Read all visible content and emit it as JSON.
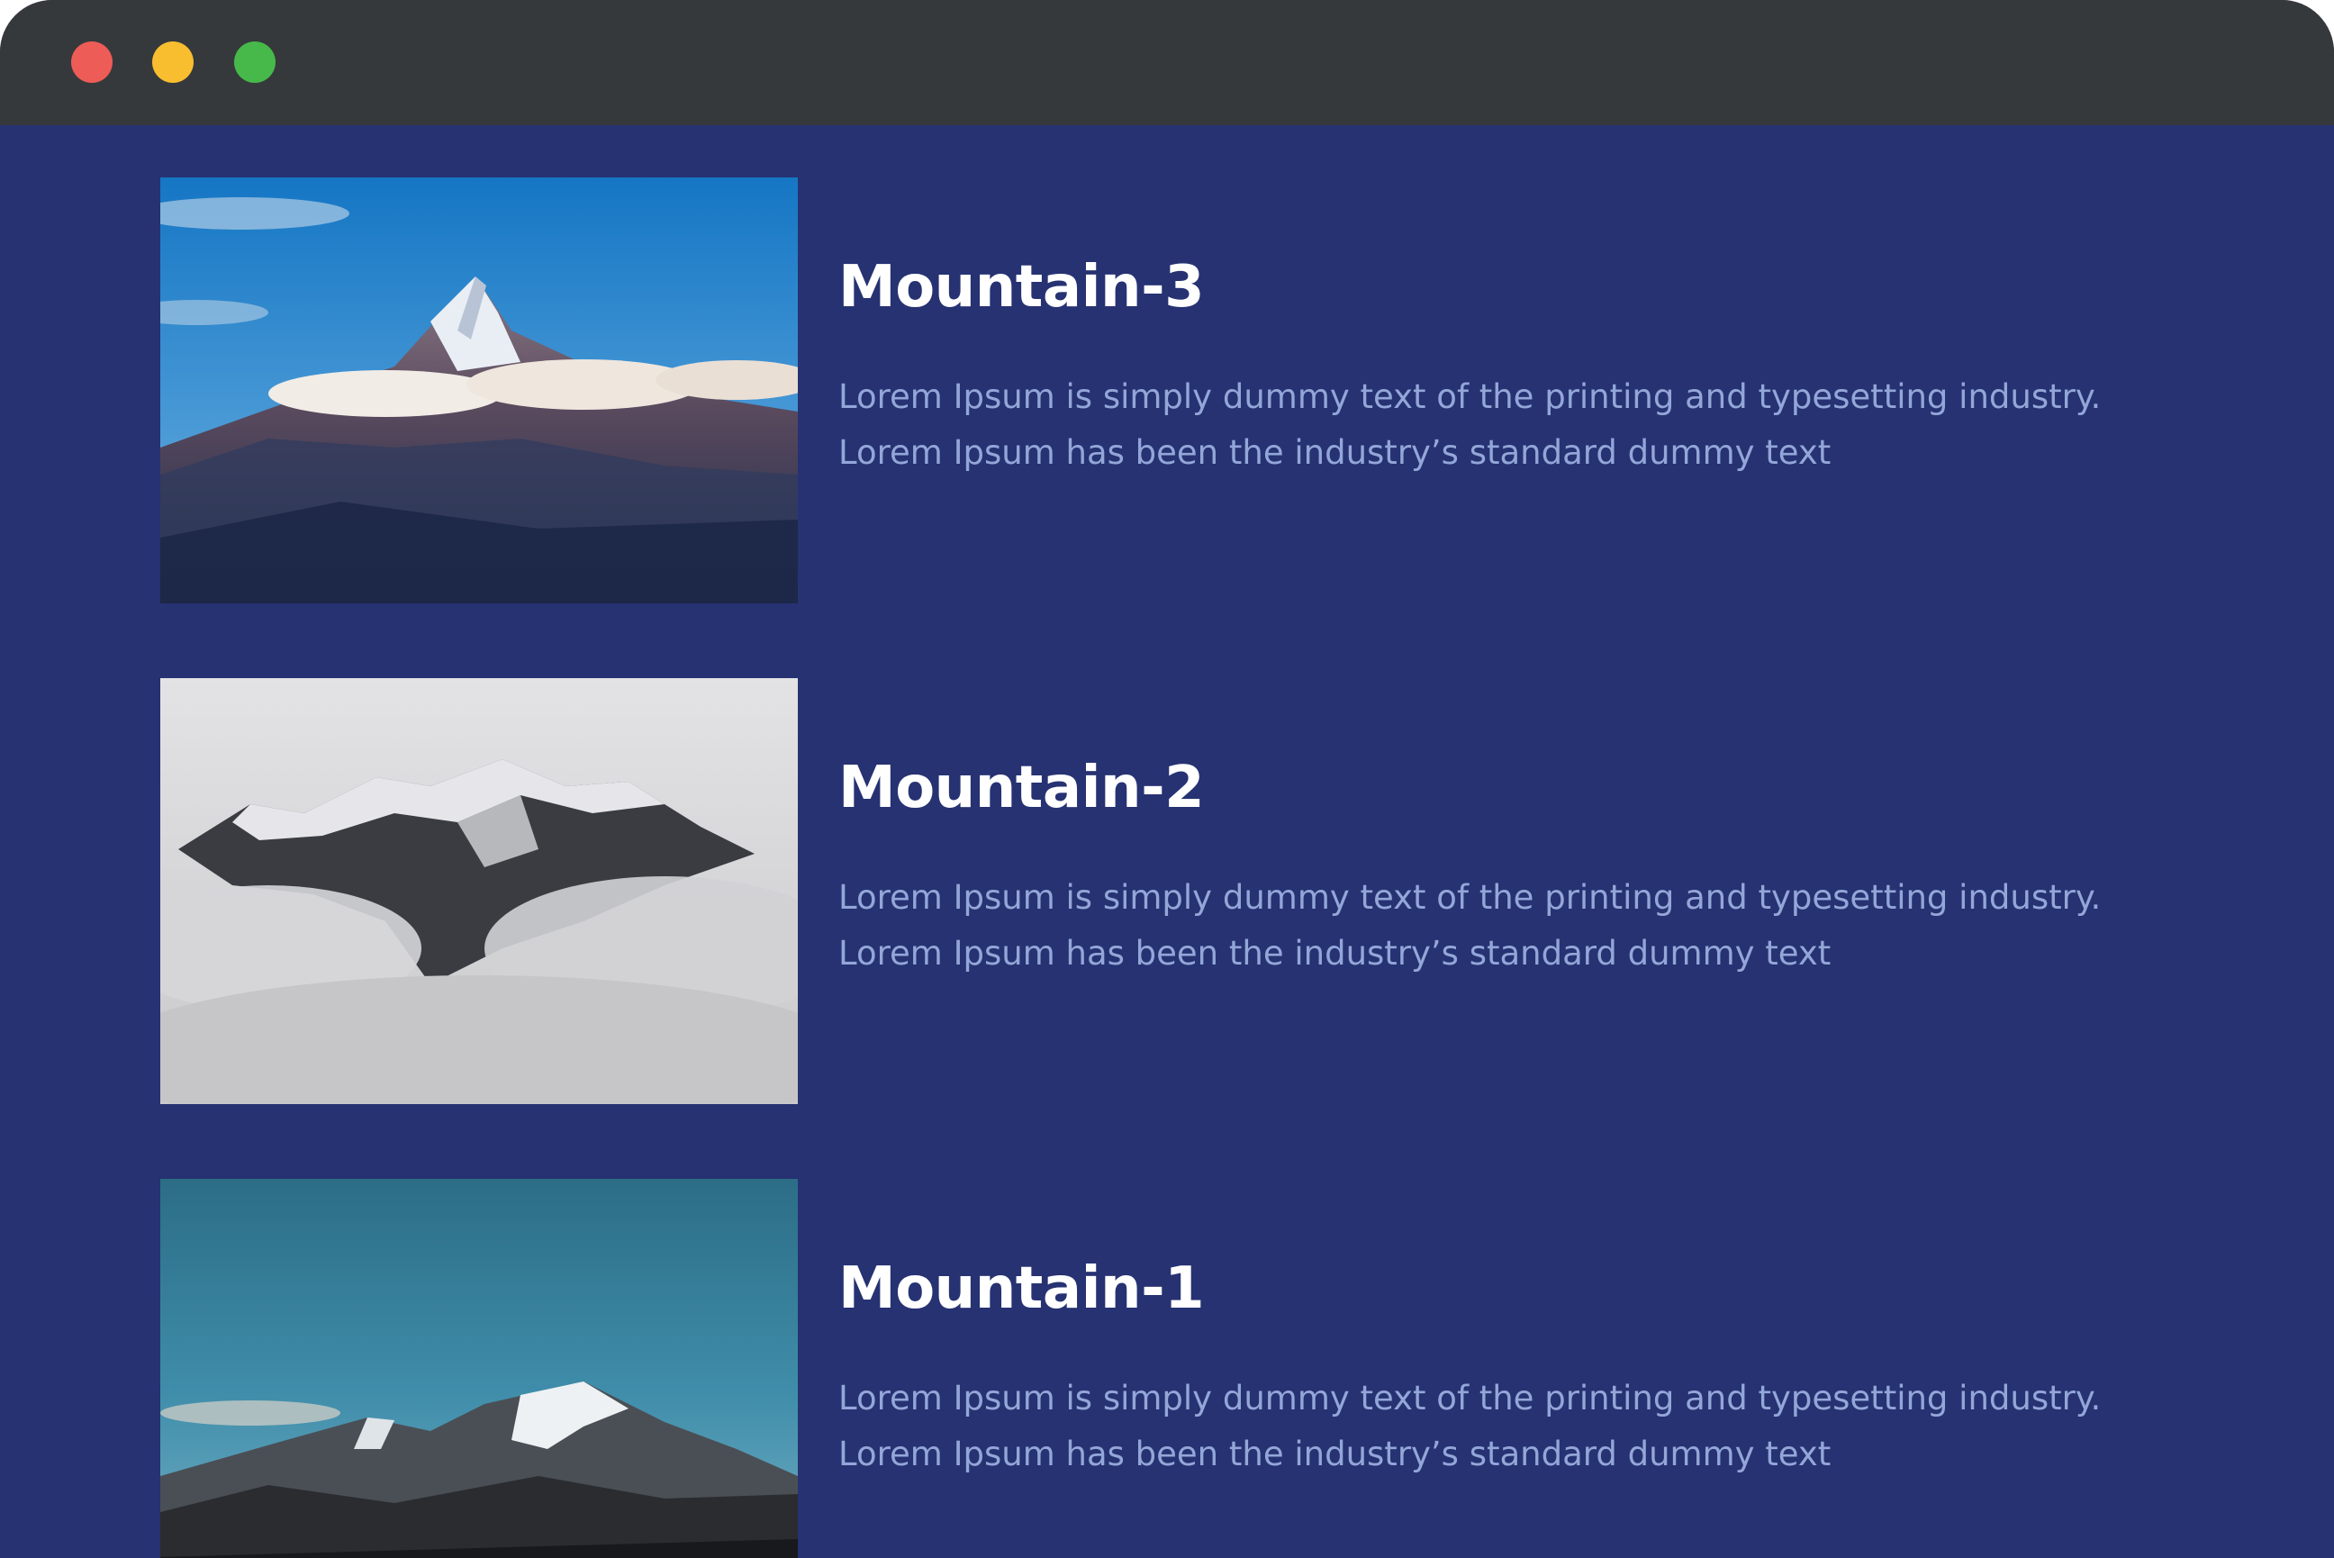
{
  "window": {
    "controls": [
      {
        "name": "close",
        "color": "#ee5c57"
      },
      {
        "name": "minimize",
        "color": "#f9bd30"
      },
      {
        "name": "maximize",
        "color": "#46b94a"
      }
    ],
    "titlebar_color": "#36393b",
    "background_color": "#263272"
  },
  "cards": [
    {
      "title": "Mountain-3",
      "line1": "Lorem Ipsum is simply dummy text of the printing and typesetting industry.",
      "line2": "Lorem Ipsum has been the industry’s standard dummy text",
      "image": "snowy-peak-above-clouds-blue-sky"
    },
    {
      "title": "Mountain-2",
      "line1": "Lorem Ipsum is simply dummy text of the printing and typesetting industry.",
      "line2": "Lorem Ipsum has been the industry’s standard dummy text",
      "image": "mountain-range-in-fog"
    },
    {
      "title": "Mountain-1",
      "line1": "Lorem Ipsum is simply dummy text of the printing and typesetting industry.",
      "line2": "Lorem Ipsum has been the industry’s standard dummy text",
      "image": "snow-capped-mountains-teal-sky"
    }
  ]
}
